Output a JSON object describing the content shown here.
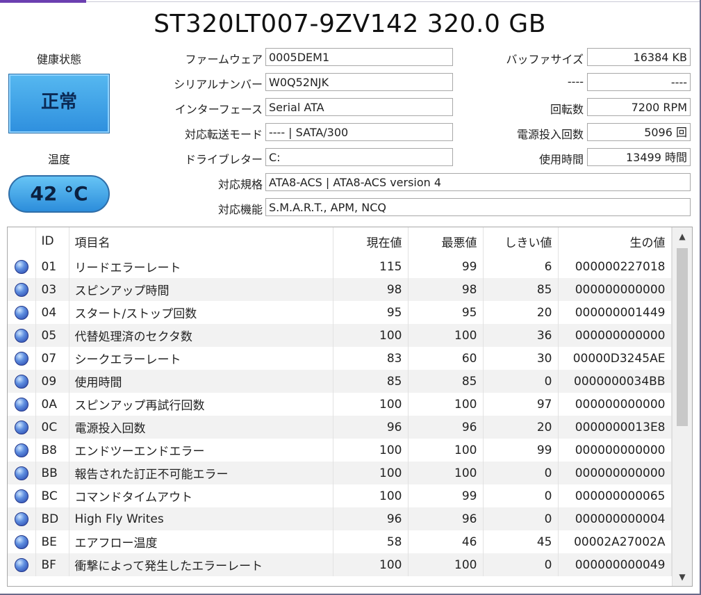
{
  "title": "ST320LT007-9ZV142 320.0 GB",
  "health": {
    "label": "健康状態",
    "status": "正常"
  },
  "temperature": {
    "label": "温度",
    "value": "42 °C"
  },
  "info": {
    "firmware": {
      "label": "ファームウェア",
      "value": "0005DEM1"
    },
    "serial": {
      "label": "シリアルナンバー",
      "value": "W0Q52NJK"
    },
    "interface": {
      "label": "インターフェース",
      "value": "Serial ATA"
    },
    "transfer_mode": {
      "label": "対応転送モード",
      "value": "---- | SATA/300"
    },
    "drive_letter": {
      "label": "ドライブレター",
      "value": "C:"
    },
    "standard": {
      "label": "対応規格",
      "value": "ATA8-ACS | ATA8-ACS version 4"
    },
    "features": {
      "label": "対応機能",
      "value": "S.M.A.R.T., APM, NCQ"
    },
    "buffer": {
      "label": "バッファサイズ",
      "value": "16384 KB"
    },
    "unknown": {
      "label": "----",
      "value": "----"
    },
    "rotation": {
      "label": "回転数",
      "value": "7200 RPM"
    },
    "power_count": {
      "label": "電源投入回数",
      "value": "5096 回"
    },
    "power_hours": {
      "label": "使用時間",
      "value": "13499 時間"
    }
  },
  "smart": {
    "headers": {
      "id": "ID",
      "name": "項目名",
      "current": "現在値",
      "worst": "最悪値",
      "threshold": "しきい値",
      "raw": "生の値"
    },
    "rows": [
      {
        "id": "01",
        "name": "リードエラーレート",
        "current": "115",
        "worst": "99",
        "threshold": "6",
        "raw": "000000227018"
      },
      {
        "id": "03",
        "name": "スピンアップ時間",
        "current": "98",
        "worst": "98",
        "threshold": "85",
        "raw": "000000000000"
      },
      {
        "id": "04",
        "name": "スタート/ストップ回数",
        "current": "95",
        "worst": "95",
        "threshold": "20",
        "raw": "000000001449"
      },
      {
        "id": "05",
        "name": "代替処理済のセクタ数",
        "current": "100",
        "worst": "100",
        "threshold": "36",
        "raw": "000000000000"
      },
      {
        "id": "07",
        "name": "シークエラーレート",
        "current": "83",
        "worst": "60",
        "threshold": "30",
        "raw": "00000D3245AE"
      },
      {
        "id": "09",
        "name": "使用時間",
        "current": "85",
        "worst": "85",
        "threshold": "0",
        "raw": "0000000034BB"
      },
      {
        "id": "0A",
        "name": "スピンアップ再試行回数",
        "current": "100",
        "worst": "100",
        "threshold": "97",
        "raw": "000000000000"
      },
      {
        "id": "0C",
        "name": "電源投入回数",
        "current": "96",
        "worst": "96",
        "threshold": "20",
        "raw": "0000000013E8"
      },
      {
        "id": "B8",
        "name": "エンドツーエンドエラー",
        "current": "100",
        "worst": "100",
        "threshold": "99",
        "raw": "000000000000"
      },
      {
        "id": "BB",
        "name": "報告された訂正不可能エラー",
        "current": "100",
        "worst": "100",
        "threshold": "0",
        "raw": "000000000000"
      },
      {
        "id": "BC",
        "name": "コマンドタイムアウト",
        "current": "100",
        "worst": "99",
        "threshold": "0",
        "raw": "000000000065"
      },
      {
        "id": "BD",
        "name": "High Fly Writes",
        "current": "96",
        "worst": "96",
        "threshold": "0",
        "raw": "000000000004"
      },
      {
        "id": "BE",
        "name": "エアフロー温度",
        "current": "58",
        "worst": "46",
        "threshold": "45",
        "raw": "00002A27002A"
      },
      {
        "id": "BF",
        "name": "衝撃によって発生したエラーレート",
        "current": "100",
        "worst": "100",
        "threshold": "0",
        "raw": "000000000049"
      }
    ]
  },
  "scrollbar": {
    "up_icon": "▲",
    "down_icon": "▼"
  }
}
